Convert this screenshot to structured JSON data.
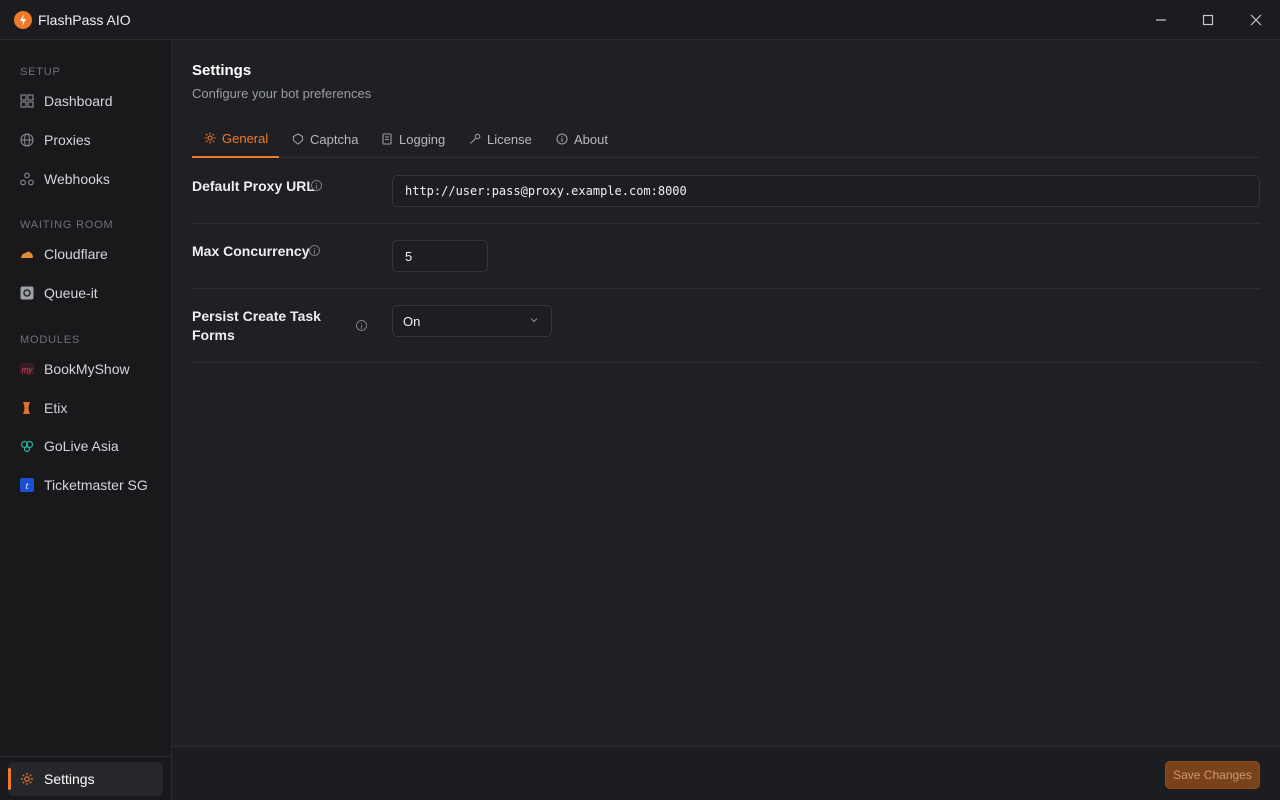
{
  "app": {
    "title": "FlashPass AIO"
  },
  "window": {
    "minimize_icon": "minimize-icon",
    "maximize_icon": "maximize-icon",
    "close_icon": "close-icon"
  },
  "sidebar": {
    "sections": [
      {
        "label": "SETUP"
      },
      {
        "label": "WAITING ROOM"
      },
      {
        "label": "MODULES"
      }
    ],
    "setup_items": [
      {
        "label": "Dashboard",
        "icon": "dashboard-icon"
      },
      {
        "label": "Proxies",
        "icon": "globe-icon"
      },
      {
        "label": "Webhooks",
        "icon": "webhook-icon"
      }
    ],
    "waiting_items": [
      {
        "label": "Cloudflare",
        "icon": "cloudflare-icon"
      },
      {
        "label": "Queue-it",
        "icon": "queue-it-icon"
      }
    ],
    "module_items": [
      {
        "label": "BookMyShow",
        "icon": "bookmyshow-icon"
      },
      {
        "label": "Etix",
        "icon": "etix-icon"
      },
      {
        "label": "GoLive Asia",
        "icon": "golive-asia-icon"
      },
      {
        "label": "Ticketmaster SG",
        "icon": "ticketmaster-icon"
      }
    ],
    "bottom_item": {
      "label": "Settings",
      "icon": "gear-icon",
      "active": true
    }
  },
  "page": {
    "title": "Settings",
    "subtitle": "Configure your bot preferences"
  },
  "tabs": [
    {
      "label": "General",
      "icon": "gear-icon",
      "active": true
    },
    {
      "label": "Captcha",
      "icon": "shield-icon"
    },
    {
      "label": "Logging",
      "icon": "scroll-icon"
    },
    {
      "label": "License",
      "icon": "key-icon"
    },
    {
      "label": "About",
      "icon": "info-icon"
    }
  ],
  "settings": {
    "proxy": {
      "label": "Default Proxy URL",
      "value": "http://user:pass@proxy.example.com:8000"
    },
    "concurrency": {
      "label": "Max Concurrency",
      "value": "5"
    },
    "persist": {
      "label": "Persist Create Task Forms",
      "value": "On"
    }
  },
  "footer": {
    "save_label": "Save Changes"
  },
  "colors": {
    "accent": "#f07a2a",
    "background": "#1f2024",
    "sidebar": "#19191c"
  }
}
